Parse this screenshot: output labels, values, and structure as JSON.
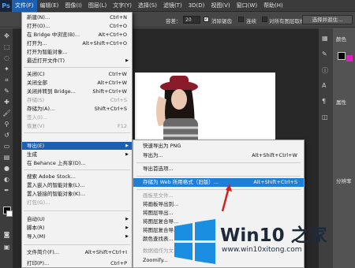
{
  "app": {
    "logo": "Ps"
  },
  "menubar": {
    "items": [
      "文件(F)",
      "编辑(E)",
      "图像(I)",
      "图层(L)",
      "文字(Y)",
      "选择(S)",
      "滤镜(T)",
      "3D(D)",
      "视图(V)",
      "窗口(W)",
      "帮助(H)"
    ],
    "active_index": 0
  },
  "options_bar": {
    "tolerance_label": "容差：",
    "tolerance_value": "20",
    "antialias_label": "消除锯齿",
    "contiguous_label": "连续",
    "sample_all_label": "对所有图层取样",
    "select_button": "选择并遮住..."
  },
  "file_menu": {
    "items": [
      {
        "label": "新建(N)...",
        "shortcut": "Ctrl+N"
      },
      {
        "label": "打开(O)...",
        "shortcut": "Ctrl+O"
      },
      {
        "label": "在 Bridge 中浏览(B)...",
        "shortcut": "Alt+Ctrl+O"
      },
      {
        "label": "打开为...",
        "shortcut": "Alt+Shift+Ctrl+O"
      },
      {
        "label": "打开为智能对象...",
        "shortcut": ""
      },
      {
        "label": "最近打开文件(T)",
        "shortcut": ""
      },
      {
        "label": "关闭(C)",
        "shortcut": "Ctrl+W"
      },
      {
        "label": "关闭全部",
        "shortcut": "Alt+Ctrl+W"
      },
      {
        "label": "关闭并转到 Bridge...",
        "shortcut": "Shift+Ctrl+W"
      },
      {
        "label": "存储(S)",
        "shortcut": "Ctrl+S"
      },
      {
        "label": "存储为(A)...",
        "shortcut": "Shift+Ctrl+S"
      },
      {
        "label": "签入(I)...",
        "shortcut": ""
      },
      {
        "label": "恢复(V)",
        "shortcut": "F12"
      },
      {
        "label": "导出(E)",
        "shortcut": ""
      },
      {
        "label": "生成",
        "shortcut": ""
      },
      {
        "label": "在 Behance 上共享(D)...",
        "shortcut": ""
      },
      {
        "label": "搜索 Adobe Stock...",
        "shortcut": ""
      },
      {
        "label": "置入嵌入的智能对象(L)...",
        "shortcut": ""
      },
      {
        "label": "置入链接的智能对象(K)...",
        "shortcut": ""
      },
      {
        "label": "打包(G)...",
        "shortcut": ""
      },
      {
        "label": "自动(U)",
        "shortcut": ""
      },
      {
        "label": "脚本(R)",
        "shortcut": ""
      },
      {
        "label": "导入(M)",
        "shortcut": ""
      },
      {
        "label": "文件简介(F)...",
        "shortcut": "Alt+Shift+Ctrl+I"
      },
      {
        "label": "打印(P)...",
        "shortcut": "Ctrl+P"
      }
    ]
  },
  "export_submenu": {
    "items": [
      {
        "label": "快速导出为 PNG",
        "shortcut": ""
      },
      {
        "label": "导出为...",
        "shortcut": "Alt+Shift+Ctrl+W"
      },
      {
        "label": "导出首选项...",
        "shortcut": ""
      },
      {
        "label": "存储为 Web 所用格式（旧版）...",
        "shortcut": "Alt+Shift+Ctrl+S"
      },
      {
        "label": "画板至文件...",
        "shortcut": ""
      },
      {
        "label": "将画板导出到...",
        "shortcut": ""
      },
      {
        "label": "将图层导出...",
        "shortcut": ""
      },
      {
        "label": "将图层复合导...",
        "shortcut": ""
      },
      {
        "label": "将图层复合导...",
        "shortcut": ""
      },
      {
        "label": "颜色查找表...",
        "shortcut": ""
      },
      {
        "label": "数据组作为文...",
        "shortcut": ""
      },
      {
        "label": "Zoomify...",
        "shortcut": ""
      }
    ]
  },
  "right_panel": {
    "color_title": "颜色",
    "properties_title": "属性",
    "channels_title": "分辨率"
  },
  "watermark": {
    "title": "Win10 之家",
    "url": "www.win10xitong.com"
  },
  "colors": {
    "menu_highlight": "#1d5fb0",
    "submenu_highlight": "#1d7fd6",
    "arrow": "#d42020",
    "win_logo": "#1a8ee0"
  }
}
